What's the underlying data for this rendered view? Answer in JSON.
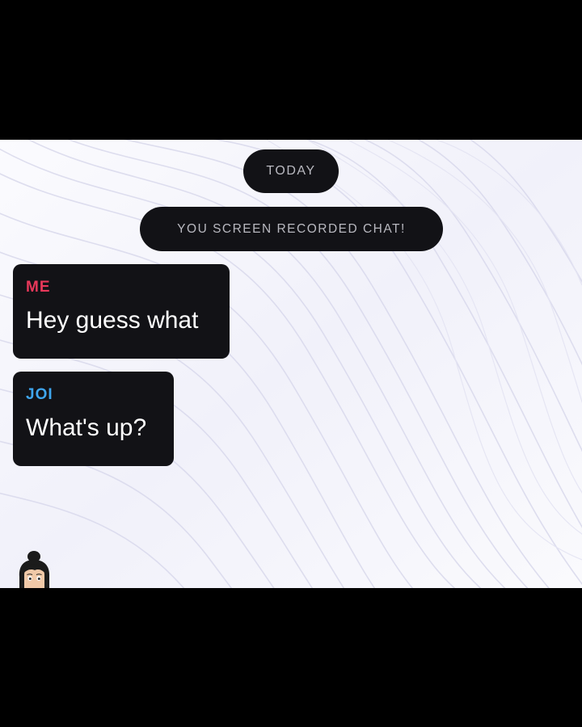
{
  "chat": {
    "date_label": "TODAY",
    "system_notice": "YOU SCREEN RECORDED CHAT!",
    "messages": [
      {
        "sender": "ME",
        "text": "Hey guess what",
        "sender_color": "#e8385a"
      },
      {
        "sender": "JOI",
        "text": "What's up?",
        "sender_color": "#3fa6ef"
      }
    ]
  },
  "colors": {
    "frame_background": "#000000",
    "chat_background": "#f6f6fc",
    "bubble_background": "#121216",
    "pill_text": "#b9b9c0"
  },
  "icons": {
    "avatar": "bitmoji-avatar-icon"
  }
}
